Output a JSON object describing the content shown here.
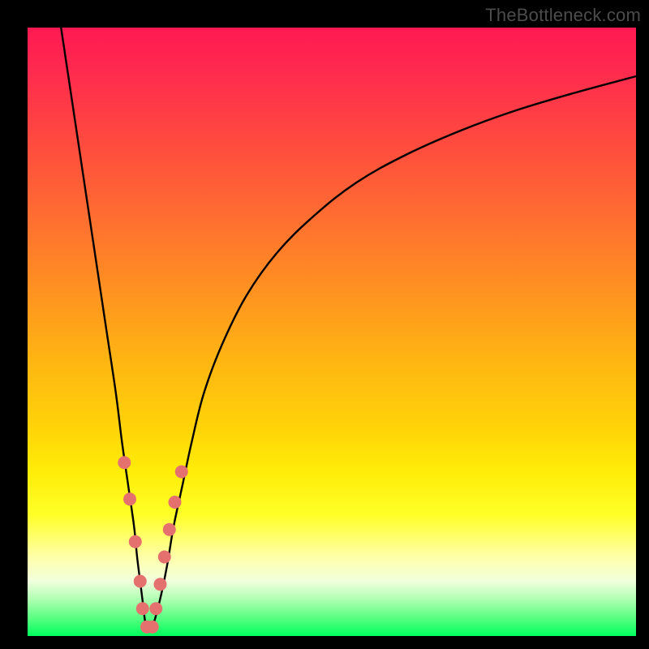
{
  "watermark": "TheBottleneck.com",
  "chart_data": {
    "type": "line",
    "title": "",
    "xlabel": "",
    "ylabel": "",
    "xlim": [
      0,
      100
    ],
    "ylim": [
      0,
      100
    ],
    "grid": false,
    "legend": false,
    "background": "sunset-gradient",
    "series": [
      {
        "name": "left-branch",
        "x": [
          5.5,
          7,
          8.5,
          10,
          11.5,
          13,
          14.5,
          15.5,
          16.5,
          17.5,
          18,
          18.5,
          19,
          19.3,
          19.6
        ],
        "y": [
          100,
          90,
          80,
          70,
          60,
          50,
          40,
          32,
          25,
          18,
          13,
          9,
          5,
          2.5,
          1.3
        ]
      },
      {
        "name": "right-branch",
        "x": [
          20.4,
          21,
          22,
          23,
          24,
          25.5,
          27,
          29,
          32,
          36,
          41,
          47,
          54,
          62,
          71,
          80,
          90,
          100
        ],
        "y": [
          1.3,
          3,
          7,
          12,
          18,
          25,
          32,
          40,
          48,
          56,
          63,
          69,
          74.5,
          79,
          83,
          86.3,
          89.3,
          92
        ]
      },
      {
        "name": "valley-floor",
        "x": [
          19.6,
          20,
          20.4
        ],
        "y": [
          1.3,
          0.8,
          1.3
        ]
      }
    ],
    "markers": {
      "name": "pink-dots",
      "color": "#e5716f",
      "radius_px": 8,
      "points": [
        {
          "x": 15.9,
          "y": 28.5
        },
        {
          "x": 16.8,
          "y": 22.5
        },
        {
          "x": 17.7,
          "y": 15.5
        },
        {
          "x": 18.5,
          "y": 9.0
        },
        {
          "x": 18.9,
          "y": 4.5
        },
        {
          "x": 19.6,
          "y": 1.5
        },
        {
          "x": 20.5,
          "y": 1.5
        },
        {
          "x": 21.1,
          "y": 4.5
        },
        {
          "x": 21.8,
          "y": 8.5
        },
        {
          "x": 22.5,
          "y": 13.0
        },
        {
          "x": 23.3,
          "y": 17.5
        },
        {
          "x": 24.2,
          "y": 22.0
        },
        {
          "x": 25.3,
          "y": 27.0
        }
      ]
    }
  }
}
